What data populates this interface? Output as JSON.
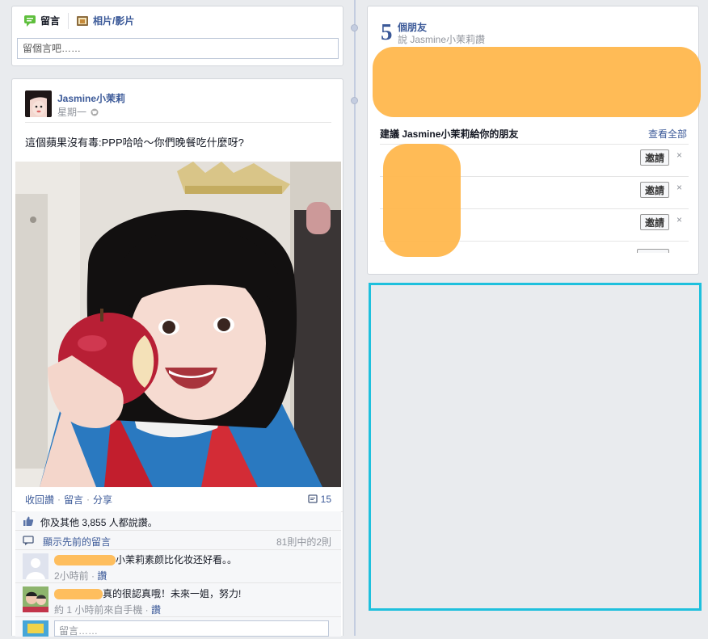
{
  "composer": {
    "tab_comment": "留言",
    "tab_photo": "相片/影片",
    "placeholder": "留個言吧……"
  },
  "post": {
    "author": "Jasmine小茉莉",
    "time": "星期一",
    "text": "這個蘋果沒有毒:PPP哈哈～你們晚餐吃什麼呀?",
    "actions": [
      "收回讚",
      "留言",
      "分享"
    ],
    "comment_count": "15",
    "likes_text": "你及其他 3,855 人都說讚。",
    "show_previous": "顯示先前的留言",
    "previous_count": "81則中的2則",
    "comments": [
      {
        "text": "小茉莉素颜比化妆还好看。。",
        "meta": "2小時前",
        "like": "讚"
      },
      {
        "text": "真的很認真哦！未來一姐，努力!",
        "meta": "約 1 小時前來自手機",
        "like": "讚"
      }
    ],
    "write_comment_placeholder": "留言……"
  },
  "friends": {
    "count": "5",
    "label": "個朋友",
    "sub": "說 Jasmine小茉莉讚",
    "suggest_heading": "建議 Jasmine小茉莉給你的朋友",
    "see_all": "查看全部",
    "invite_label": "邀請",
    "dismiss": "×"
  },
  "colors": {
    "link": "#3b5998",
    "redaction": "#ffb74d",
    "ad_border": "#1ec0dd",
    "background": "#e9ebee"
  }
}
